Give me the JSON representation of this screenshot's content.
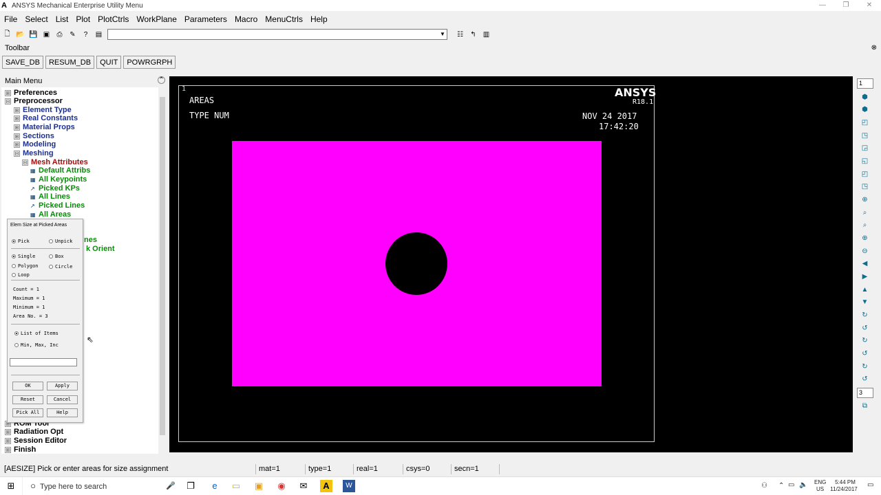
{
  "window": {
    "title": "ANSYS Mechanical Enterprise Utility Menu",
    "logo": "A",
    "controls": [
      "—",
      "❐",
      "✕"
    ]
  },
  "menubar": [
    "File",
    "Select",
    "List",
    "Plot",
    "PlotCtrls",
    "WorkPlane",
    "Parameters",
    "Macro",
    "MenuCtrls",
    "Help"
  ],
  "toolbar": {
    "label": "Toolbar",
    "buttons": [
      "SAVE_DB",
      "RESUM_DB",
      "QUIT",
      "POWRGRPH"
    ]
  },
  "main_menu": {
    "label": "Main Menu",
    "items": [
      {
        "label": "Preferences",
        "level": 0,
        "marker": "⊞"
      },
      {
        "label": "Preprocessor",
        "level": 0,
        "marker": "⊟"
      },
      {
        "label": "Element Type",
        "level": 1,
        "marker": "⊞"
      },
      {
        "label": "Real Constants",
        "level": 1,
        "marker": "⊞"
      },
      {
        "label": "Material Props",
        "level": 1,
        "marker": "⊞"
      },
      {
        "label": "Sections",
        "level": 1,
        "marker": "⊞"
      },
      {
        "label": "Modeling",
        "level": 1,
        "marker": "⊞"
      },
      {
        "label": "Meshing",
        "level": 1,
        "marker": "⊟"
      },
      {
        "label": "Mesh Attributes",
        "level": 2,
        "marker": "⊟"
      },
      {
        "label": "Default Attribs",
        "level": 3,
        "marker": "▦"
      },
      {
        "label": "All Keypoints",
        "level": 3,
        "marker": "▦"
      },
      {
        "label": "Picked KPs",
        "level": 3,
        "marker": "↗"
      },
      {
        "label": "All Lines",
        "level": 3,
        "marker": "▦"
      },
      {
        "label": "Picked Lines",
        "level": 3,
        "marker": "↗"
      },
      {
        "label": "All Areas",
        "level": 3,
        "marker": "▦"
      }
    ],
    "partial_items": [
      "nes",
      "k Orient"
    ],
    "bottom_items": [
      "ROM Tool",
      "Radiation Opt",
      "Session Editor",
      "Finish"
    ]
  },
  "picker": {
    "title": "Elem Size at Picked Areas",
    "mode": [
      "Pick",
      "Unpick"
    ],
    "shape": [
      "Single",
      "Box",
      "Polygon",
      "Circle",
      "Loop"
    ],
    "stats": [
      "Count   =  1",
      "Maximum  =  1",
      "Minimum  =  1",
      "Area No. =  3"
    ],
    "entry": [
      "List of Items",
      "Min, Max, Inc"
    ],
    "buttons": [
      "OK",
      "Apply",
      "Reset",
      "Cancel",
      "Pick All",
      "Help"
    ]
  },
  "graphics": {
    "window_number": "1",
    "label1": "AREAS",
    "label2": "TYPE NUM",
    "brand": "ANSYS",
    "version": "R18.1",
    "date": "NOV 24 2017",
    "time": "17:42:20",
    "area_color": "#ff00ff"
  },
  "right_toolbar": {
    "top_select": "1",
    "bottom_select": "3"
  },
  "status": {
    "prompt": "[AESIZE]  Pick or enter areas for size assignment",
    "mat": "mat=1",
    "type": "type=1",
    "real": "real=1",
    "csys": "csys=0",
    "secn": "secn=1"
  },
  "taskbar": {
    "search_placeholder": "Type here to search",
    "lang": "ENG",
    "region": "US",
    "time": "5:44 PM",
    "date": "11/24/2017"
  }
}
